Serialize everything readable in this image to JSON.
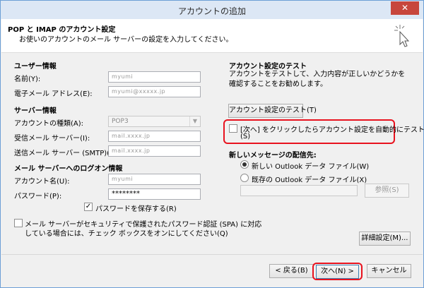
{
  "window": {
    "title": "アカウントの追加",
    "close_glyph": "✕"
  },
  "header": {
    "title": "POP と IMAP のアカウント設定",
    "subtitle": "お使いのアカウントのメール サーバーの設定を入力してください。"
  },
  "user_info": {
    "section": "ユーザー情報",
    "name_label": "名前(Y):",
    "name_value": "myumi",
    "email_label": "電子メール アドレス(E):",
    "email_value": "myumi@xxxxx.jp"
  },
  "server_info": {
    "section": "サーバー情報",
    "account_type_label": "アカウントの種類(A):",
    "account_type_value": "POP3",
    "incoming_label": "受信メール サーバー(I):",
    "incoming_value": "mail.xxxx.jp",
    "outgoing_label": "送信メール サーバー (SMTP)(O):",
    "outgoing_value": "mail.xxxx.jp"
  },
  "logon_info": {
    "section": "メール サーバーへのログオン情報",
    "account_name_label": "アカウント名(U):",
    "account_name_value": "myumi",
    "password_label": "パスワード(P):",
    "password_value": "********",
    "save_password_label": "パスワードを保存する(R)",
    "spa_label_line1": "メール サーバーがセキュリティで保護されたパスワード認証 (SPA) に対応",
    "spa_label_line2": "している場合には、チェック ボックスをオンにしてください(Q)"
  },
  "test": {
    "section": "アカウント設定のテスト",
    "description": "アカウントをテストして、入力内容が正しいかどうかを確認することをお勧めします。",
    "test_button": "アカウント設定のテスト(T)",
    "auto_test_line1": "[次へ] をクリックしたらアカウント設定を自動的にテストする",
    "auto_test_line2": "(S)"
  },
  "delivery": {
    "section": "新しいメッセージの配信先:",
    "new_file_label": "新しい Outlook データ ファイル(W)",
    "existing_file_label": "既存の Outlook データ ファイル(X)",
    "browse_button": "参照(S)"
  },
  "buttons": {
    "advanced": "詳細設定(M)...",
    "back": "< 戻る(B)",
    "next": "次へ(N) >",
    "cancel": "キャンセル"
  },
  "check_glyph": "✓",
  "colors": {
    "highlight": "#e8121e"
  }
}
